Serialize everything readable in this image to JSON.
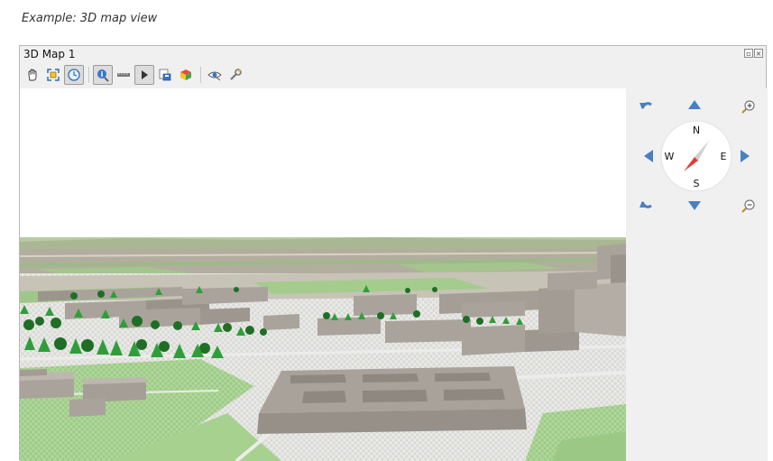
{
  "caption": "Example: 3D map view",
  "window": {
    "title": "3D Map 1",
    "buttons": [
      "float-button",
      "close-button"
    ]
  },
  "toolbar": {
    "tools": [
      {
        "icon": "pan-hand-icon",
        "active": false
      },
      {
        "icon": "zoom-full-icon",
        "active": false
      },
      {
        "icon": "camera-control-icon",
        "active": true
      },
      {
        "icon": "identify-icon",
        "active": true
      },
      {
        "icon": "measure-line-icon",
        "active": false
      },
      {
        "icon": "animation-play-icon",
        "active": true
      },
      {
        "icon": "save-image-icon",
        "active": false
      },
      {
        "icon": "export-3d-scene-icon",
        "active": false
      },
      {
        "icon": "view-eye-icon",
        "active": false
      },
      {
        "icon": "configure-wrench-icon",
        "active": false
      }
    ]
  },
  "navigation": {
    "compass": {
      "north": "N",
      "south": "S",
      "east": "E",
      "west": "W"
    },
    "controls": [
      "rotate-ccw-icon",
      "tilt-up-icon",
      "zoom-in-icon",
      "pan-left-icon",
      "pan-right-icon",
      "rotate-cw-icon",
      "tilt-down-icon",
      "zoom-out-icon"
    ]
  },
  "colors": {
    "sky": "#ffffff",
    "buildings": "#aaa39b",
    "grass": "#8fc27a",
    "trees": "#2f9e3a",
    "compass_needle": "#e53935",
    "nav_arrows": "#4a7fc0"
  }
}
